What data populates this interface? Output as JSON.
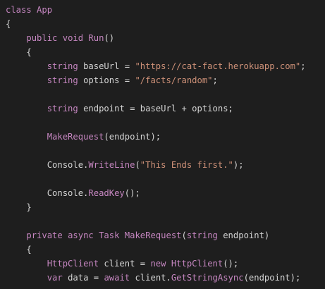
{
  "editor": {
    "lines": [
      [
        {
          "t": "class ",
          "c": "kw"
        },
        {
          "t": "App",
          "c": "kw"
        }
      ],
      [
        {
          "t": "{",
          "c": "plain"
        }
      ],
      [
        {
          "t": "    ",
          "c": "plain"
        },
        {
          "t": "public ",
          "c": "kw"
        },
        {
          "t": "void ",
          "c": "kw"
        },
        {
          "t": "Run",
          "c": "fn"
        },
        {
          "t": "()",
          "c": "plain"
        }
      ],
      [
        {
          "t": "    {",
          "c": "plain"
        }
      ],
      [
        {
          "t": "        ",
          "c": "plain"
        },
        {
          "t": "string ",
          "c": "kw"
        },
        {
          "t": "baseUrl = ",
          "c": "plain"
        },
        {
          "t": "\"https://cat-fact.herokuapp.com\"",
          "c": "str"
        },
        {
          "t": ";",
          "c": "plain"
        }
      ],
      [
        {
          "t": "        ",
          "c": "plain"
        },
        {
          "t": "string ",
          "c": "kw"
        },
        {
          "t": "options = ",
          "c": "plain"
        },
        {
          "t": "\"/facts/random\"",
          "c": "str"
        },
        {
          "t": ";",
          "c": "plain"
        }
      ],
      [],
      [
        {
          "t": "        ",
          "c": "plain"
        },
        {
          "t": "string ",
          "c": "kw"
        },
        {
          "t": "endpoint = baseUrl + options;",
          "c": "plain"
        }
      ],
      [],
      [
        {
          "t": "        ",
          "c": "plain"
        },
        {
          "t": "MakeRequest",
          "c": "fn"
        },
        {
          "t": "(endpoint);",
          "c": "plain"
        }
      ],
      [],
      [
        {
          "t": "        Console.",
          "c": "plain"
        },
        {
          "t": "WriteLine",
          "c": "fn"
        },
        {
          "t": "(",
          "c": "plain"
        },
        {
          "t": "\"This Ends first.\"",
          "c": "str"
        },
        {
          "t": ");",
          "c": "plain"
        }
      ],
      [],
      [
        {
          "t": "        Console.",
          "c": "plain"
        },
        {
          "t": "ReadKey",
          "c": "fn"
        },
        {
          "t": "();",
          "c": "plain"
        }
      ],
      [
        {
          "t": "    }",
          "c": "plain"
        }
      ],
      [],
      [
        {
          "t": "    ",
          "c": "plain"
        },
        {
          "t": "private ",
          "c": "kw"
        },
        {
          "t": "async ",
          "c": "kw"
        },
        {
          "t": "Task ",
          "c": "kw"
        },
        {
          "t": "MakeRequest",
          "c": "fn"
        },
        {
          "t": "(",
          "c": "plain"
        },
        {
          "t": "string ",
          "c": "kw"
        },
        {
          "t": "endpoint)",
          "c": "plain"
        }
      ],
      [
        {
          "t": "    {",
          "c": "plain"
        }
      ],
      [
        {
          "t": "        ",
          "c": "plain"
        },
        {
          "t": "HttpClient ",
          "c": "kw"
        },
        {
          "t": "client = ",
          "c": "plain"
        },
        {
          "t": "new ",
          "c": "kw"
        },
        {
          "t": "HttpClient",
          "c": "fn"
        },
        {
          "t": "();",
          "c": "plain"
        }
      ],
      [
        {
          "t": "        ",
          "c": "plain"
        },
        {
          "t": "var ",
          "c": "kw"
        },
        {
          "t": "data = ",
          "c": "plain"
        },
        {
          "t": "await ",
          "c": "kw"
        },
        {
          "t": "client.",
          "c": "plain"
        },
        {
          "t": "GetStringAsync",
          "c": "fn"
        },
        {
          "t": "(endpoint);",
          "c": "plain"
        }
      ]
    ]
  }
}
